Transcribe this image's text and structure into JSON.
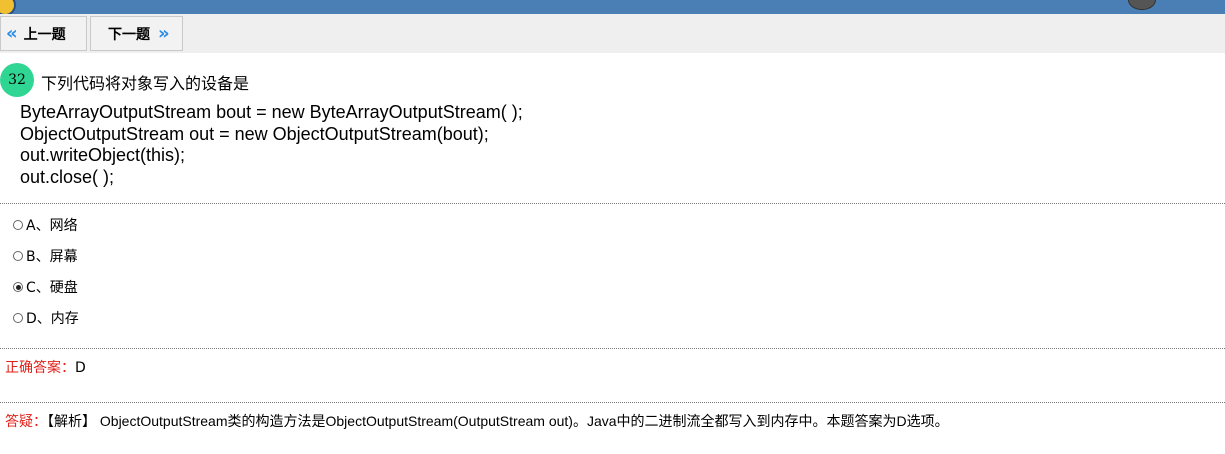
{
  "nav": {
    "prev_icon": "«",
    "prev_label": "上一题",
    "next_label": "下一题",
    "next_icon": "»"
  },
  "question": {
    "number": "32",
    "title": "下列代码将对象写入的设备是",
    "code": [
      "ByteArrayOutputStream bout = new ByteArrayOutputStream( );",
      "ObjectOutputStream out = new ObjectOutputStream(bout);",
      "out.writeObject(this);",
      "out.close( );"
    ],
    "options": [
      {
        "label": "A、网络",
        "selected": false
      },
      {
        "label": "B、屏幕",
        "selected": false
      },
      {
        "label": "C、硬盘",
        "selected": true
      },
      {
        "label": "D、内存",
        "selected": false
      }
    ]
  },
  "answer": {
    "label": "正确答案：",
    "value": "D"
  },
  "explanation": {
    "label": "答疑：",
    "text": "【解析】 ObjectOutputStream类的构造方法是ObjectOutputStream(OutputStream out)。Java中的二进制流全都写入到内存中。本题答案为D选项。"
  },
  "colors": {
    "topbar": "#4a7fb5",
    "number_badge": "#2fd592",
    "chevron": "#2b8be6",
    "label_red": "#e0211a"
  }
}
